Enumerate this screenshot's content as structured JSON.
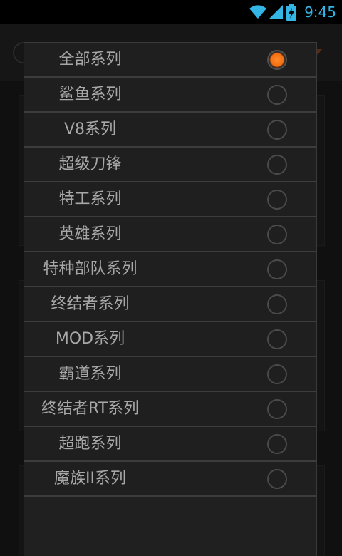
{
  "status_bar": {
    "time": "9:45",
    "icons": [
      "wifi-icon",
      "signal-icon",
      "battery-charging-icon"
    ],
    "accent_color": "#33b5e5"
  },
  "dialog": {
    "selected_index": 0,
    "accent_color": "#f26f12",
    "options": [
      {
        "label": "全部系列",
        "checked": true
      },
      {
        "label": "鲨鱼系列",
        "checked": false
      },
      {
        "label": "V8系列",
        "checked": false
      },
      {
        "label": "超级刀锋",
        "checked": false
      },
      {
        "label": "特工系列",
        "checked": false
      },
      {
        "label": "英雄系列",
        "checked": false
      },
      {
        "label": "特种部队系列",
        "checked": false
      },
      {
        "label": "终结者系列",
        "checked": false
      },
      {
        "label": "MOD系列",
        "checked": false
      },
      {
        "label": "霸道系列",
        "checked": false
      },
      {
        "label": "终结者RT系列",
        "checked": false
      },
      {
        "label": "超跑系列",
        "checked": false
      },
      {
        "label": "魔族II系列",
        "checked": false
      }
    ]
  }
}
